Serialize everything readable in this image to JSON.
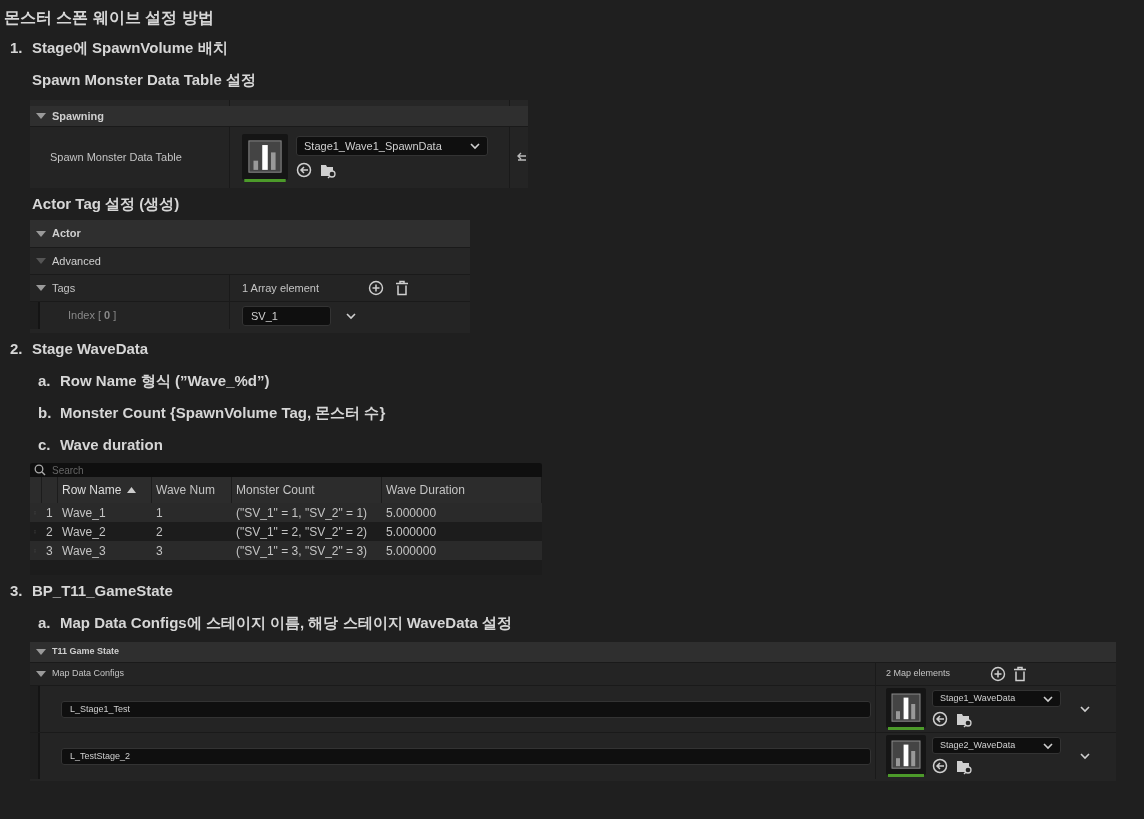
{
  "title": "몬스터 스폰 웨이브 설정 방법",
  "steps": [
    {
      "marker": "1.",
      "text": "Stage에 SpawnVolume 배치",
      "blocks": [
        {
          "kind": "heading",
          "text": "Spawn Monster Data Table 설정"
        },
        {
          "kind": "asset_panel",
          "category": {
            "label": "Spawning",
            "expanded": true
          },
          "property": {
            "label": "Spawn Monster Data Table",
            "asset": "Stage1_Wave1_SpawnData"
          }
        },
        {
          "kind": "heading",
          "text": "Actor Tag 설정 (생성)"
        },
        {
          "kind": "tags_panel",
          "category": {
            "label": "Actor",
            "expanded": true
          },
          "advanced": {
            "label": "Advanced"
          },
          "tags": {
            "label": "Tags",
            "expanded": true,
            "count": "1 Array element",
            "elements": [
              {
                "label": "Index [ **0** ]",
                "value": "SV_1"
              }
            ]
          }
        }
      ]
    },
    {
      "marker": "2.",
      "text": "Stage WaveData",
      "blocks": [
        {
          "kind": "item",
          "marker": "a.",
          "text": "Row Name 형식 (”Wave_%d”)"
        },
        {
          "kind": "item",
          "marker": "b.",
          "text": "Monster Count {SpawnVolume Tag, 몬스터 수}"
        },
        {
          "kind": "item",
          "marker": "c.",
          "text": "Wave duration"
        },
        {
          "kind": "data_table",
          "search": {
            "placeholder": "Search"
          },
          "columns": [
            {
              "label": "Row Name",
              "sorted": true
            },
            {
              "label": "Wave Num",
              "sorted": false
            },
            {
              "label": "Monster Count",
              "sorted": false
            },
            {
              "label": "Wave Duration",
              "sorted": false
            }
          ],
          "rows": [
            {
              "index": "1",
              "cells": [
                "Wave_1",
                "1",
                "(\"SV_1\" = 1, \"SV_2\" = 1)",
                "5.000000"
              ]
            },
            {
              "index": "2",
              "cells": [
                "Wave_2",
                "2",
                "(\"SV_1\" = 2, \"SV_2\" = 2)",
                "5.000000"
              ]
            },
            {
              "index": "3",
              "cells": [
                "Wave_3",
                "3",
                "(\"SV_1\" = 3, \"SV_2\" = 3)",
                "5.000000"
              ]
            }
          ]
        }
      ]
    },
    {
      "marker": "3.",
      "text": "BP_T11_GameState",
      "blocks": [
        {
          "kind": "item",
          "marker": "a.",
          "text": "Map Data Configs에 스테이지 이름, 해당 스테이지 WaveData 설정"
        },
        {
          "kind": "map_panel",
          "category": {
            "label": "T11 Game State",
            "expanded": true
          },
          "map": {
            "label": "Map Data Configs",
            "expanded": true,
            "count": "2 Map elements",
            "entries": [
              {
                "key": "L_Stage1_Test",
                "asset": "Stage1_WaveData"
              },
              {
                "key": "L_TestStage_2",
                "asset": "Stage2_WaveData"
              }
            ]
          }
        }
      ]
    }
  ]
}
